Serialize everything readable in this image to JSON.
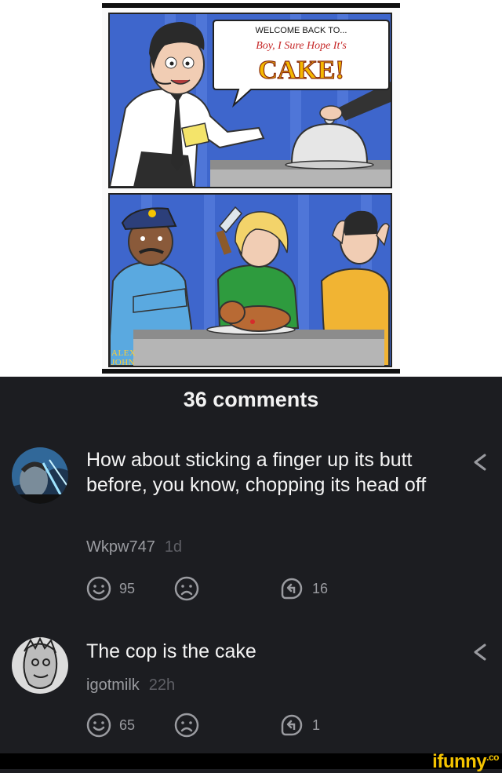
{
  "comic": {
    "bubble_line1": "WELCOME BACK TO...",
    "bubble_line2": "Boy, I Sure Hope It's",
    "bubble_line3": "CAKE!",
    "signature_line1": "ALEX",
    "signature_line2": "JOHN"
  },
  "comments_header": "36 comments",
  "comments": [
    {
      "text": "How about sticking a finger up its butt before, you know, chopping its head off",
      "username": "Wkpw747",
      "time": "1d",
      "smile_count": "95",
      "reply_count": "16"
    },
    {
      "text": "The cop is the cake",
      "username": "igotmilk",
      "time": "22h",
      "smile_count": "65",
      "reply_count": "1"
    }
  ],
  "brand": {
    "logo": "ifunny",
    "logo_suffix": ".co",
    "color": "#f5c400"
  },
  "icons": [
    "smile-icon",
    "frown-icon",
    "reply-icon",
    "share-icon"
  ]
}
